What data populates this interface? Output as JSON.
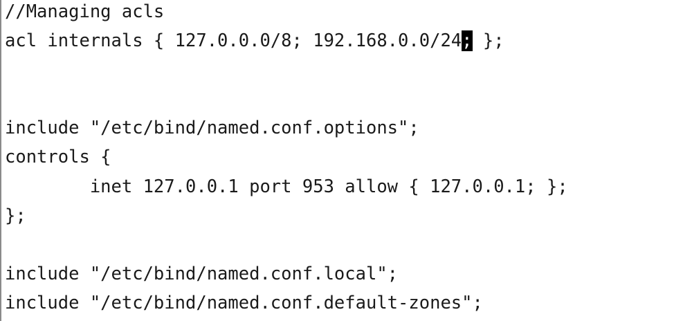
{
  "editor": {
    "lines": [
      "//Managing acls",
      "acl internals { 127.0.0.0/8; 192.168.0.0/24",
      "",
      "",
      "include \"/etc/bind/named.conf.options\";",
      "controls {",
      "        inet 127.0.0.1 port 953 allow { 127.0.0.1; };",
      "};",
      "",
      "include \"/etc/bind/named.conf.local\";",
      "include \"/etc/bind/named.conf.default-zones\";"
    ],
    "cursor_char": ";",
    "line_after_cursor": " };"
  },
  "colors": {
    "background": "#ffffff",
    "text": "#1a1a1a",
    "cursor": "#000000"
  }
}
